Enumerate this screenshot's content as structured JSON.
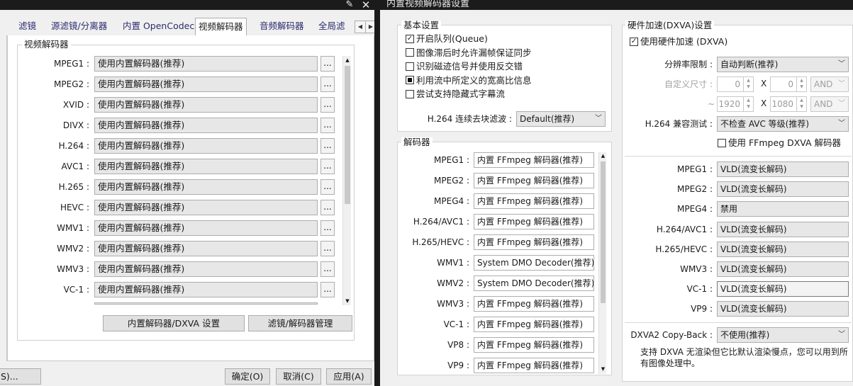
{
  "left_window": {
    "tabs": [
      "滤镜",
      "源滤镜/分离器",
      "内置 OpenCodec",
      "视频解码器",
      "音频解码器",
      "全局滤"
    ],
    "active_tab": "视频解码器",
    "group_title": "视频解码器",
    "rows": [
      {
        "label": "MPEG1 :",
        "value": "使用内置解码器(推荐)"
      },
      {
        "label": "MPEG2 :",
        "value": "使用内置解码器(推荐)"
      },
      {
        "label": "XVID :",
        "value": "使用内置解码器(推荐)"
      },
      {
        "label": "DIVX :",
        "value": "使用内置解码器(推荐)"
      },
      {
        "label": "H.264 :",
        "value": "使用内置解码器(推荐)"
      },
      {
        "label": "AVC1 :",
        "value": "使用内置解码器(推荐)"
      },
      {
        "label": "H.265 :",
        "value": "使用内置解码器(推荐)"
      },
      {
        "label": "HEVC :",
        "value": "使用内置解码器(推荐)"
      },
      {
        "label": "WMV1 :",
        "value": "使用内置解码器(推荐)"
      },
      {
        "label": "WMV2 :",
        "value": "使用内置解码器(推荐)"
      },
      {
        "label": "WMV3 :",
        "value": "使用内置解码器(推荐)"
      },
      {
        "label": "VC-1 :",
        "value": "使用内置解码器(推荐)"
      }
    ],
    "dots_label": "...",
    "dxva_button": "内置解码器/DXVA 设置",
    "filter_manager_button": "滤镜/解码器管理",
    "bottom_left_button": "S)...",
    "ok_button": "确定(O)",
    "cancel_button": "取消(C)",
    "apply_button": "应用(A)"
  },
  "right_window": {
    "title": "内置视频解码器设置",
    "basic": {
      "title": "基本设置",
      "checks": [
        {
          "label": "开启队列(Queue)",
          "state": "checked"
        },
        {
          "label": "图像滞后时允许漏帧保证同步",
          "state": "unchecked"
        },
        {
          "label": "识别磁迹信号并使用反交错",
          "state": "unchecked"
        },
        {
          "label": "利用流中所定义的宽高比信息",
          "state": "indeterminate"
        },
        {
          "label": "尝试支持隐藏式字幕流",
          "state": "unchecked"
        }
      ],
      "deblock_label": "H.264 连续去块滤波 :",
      "deblock_value": "Default(推荐)"
    },
    "decoders": {
      "title": "解码器",
      "rows": [
        {
          "label": "MPEG1 :",
          "value": "内置 FFmpeg 解码器(推荐)"
        },
        {
          "label": "MPEG2 :",
          "value": "内置 FFmpeg 解码器(推荐)"
        },
        {
          "label": "MPEG4 :",
          "value": "内置 FFmpeg 解码器(推荐)"
        },
        {
          "label": "H.264/AVC1 :",
          "value": "内置 FFmpeg 解码器(推荐)"
        },
        {
          "label": "H.265/HEVC :",
          "value": "内置 FFmpeg 解码器(推荐)"
        },
        {
          "label": "WMV1 :",
          "value": "System DMO Decoder(推荐)"
        },
        {
          "label": "WMV2 :",
          "value": "System DMO Decoder(推荐)"
        },
        {
          "label": "WMV3 :",
          "value": "内置 FFmpeg 解码器(推荐)"
        },
        {
          "label": "VC-1 :",
          "value": "内置 FFmpeg 解码器(推荐)"
        },
        {
          "label": "VP8 :",
          "value": "内置 FFmpeg 解码器(推荐)"
        },
        {
          "label": "VP9 :",
          "value": "内置 FFmpeg 解码器(推荐)"
        }
      ]
    },
    "hw": {
      "title": "硬件加速(DXVA)设置",
      "use_hw_label": "使用硬件加速 (DXVA)",
      "res_limit_label": "分辨率限制 :",
      "res_limit_value": "自动判断(推荐)",
      "custom_size_label": "自定义尺寸 :",
      "min_w": "0",
      "min_h": "0",
      "max_w": "1920",
      "max_h": "1080",
      "x_sep": "X",
      "tilde": "~",
      "and_label": "AND",
      "h264_compat_label": "H.264 兼容测试 :",
      "h264_compat_value": "不检查 AVC 等级(推荐)",
      "ffmpeg_dxva_label": "使用 FFmpeg DXVA 解码器",
      "rows": [
        {
          "label": "MPEG1 :",
          "value": "VLD(流变长解码)"
        },
        {
          "label": "MPEG2 :",
          "value": "VLD(流变长解码)"
        },
        {
          "label": "MPEG4 :",
          "value": "禁用"
        },
        {
          "label": "H.264/AVC1 :",
          "value": "VLD(流变长解码)"
        },
        {
          "label": "H.265/HEVC :",
          "value": "VLD(流变长解码)"
        },
        {
          "label": "WMV3 :",
          "value": "VLD(流变长解码)"
        },
        {
          "label": "VC-1 :",
          "value": "VLD(流变长解码)"
        },
        {
          "label": "VP9 :",
          "value": "VLD(流变长解码)"
        }
      ],
      "copyback_label": "DXVA2 Copy-Back :",
      "copyback_value": "不使用(推荐)",
      "note": "支持 DXVA 无渲染但它比默认渲染慢点，您可以用到所有图像处理中。"
    }
  }
}
